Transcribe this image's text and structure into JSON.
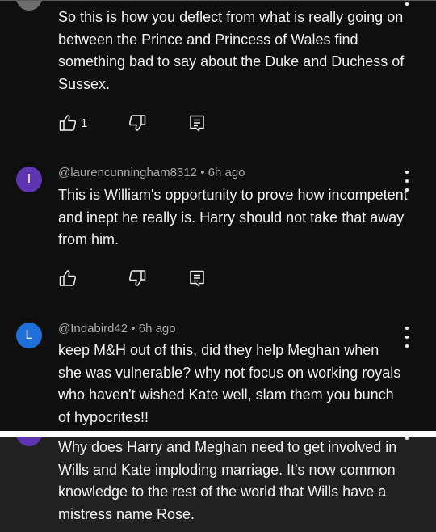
{
  "colors": {
    "background": "#0f0f0f",
    "text": "#f1f1f1",
    "meta_text": "#aaaaaa",
    "avatar_i": "#5e35b1",
    "avatar_l": "#1e6fd9",
    "avatar_top": "#6d6d6d",
    "avatar_partial": "#5e35b1"
  },
  "comments": [
    {
      "body": "So this is how you deflect from what is really going on between the Prince and Princess of Wales find something bad to say about the Duke and Duchess of Sussex.",
      "likes": "1",
      "icons": [
        "thumbs-up-icon",
        "thumbs-down-icon",
        "reply-icon"
      ]
    },
    {
      "avatar_letter": "I",
      "author": "@laurencunningham8312",
      "time": "6h ago",
      "body": "This is William's opportunity to prove how incompetent and inept he really is. Harry should not take that away from him.",
      "icons": [
        "thumbs-up-icon",
        "thumbs-down-icon",
        "reply-icon",
        "more-vert-icon"
      ]
    },
    {
      "avatar_letter": "L",
      "author": "@Indabird42",
      "time": "6h ago",
      "body": "keep M&H out of this,  did they help Meghan when she was vulnerable? why not focus on working royals who haven't wished Kate well, slam them you bunch of hypocrites!!",
      "icons": [
        "more-vert-icon"
      ]
    },
    {
      "body": "Why does Harry and Meghan need to get involved in Wills and Kate imploding marriage. It's now common knowledge to the rest of the world that Wills have a mistress name Rose."
    }
  ],
  "separator": "•"
}
